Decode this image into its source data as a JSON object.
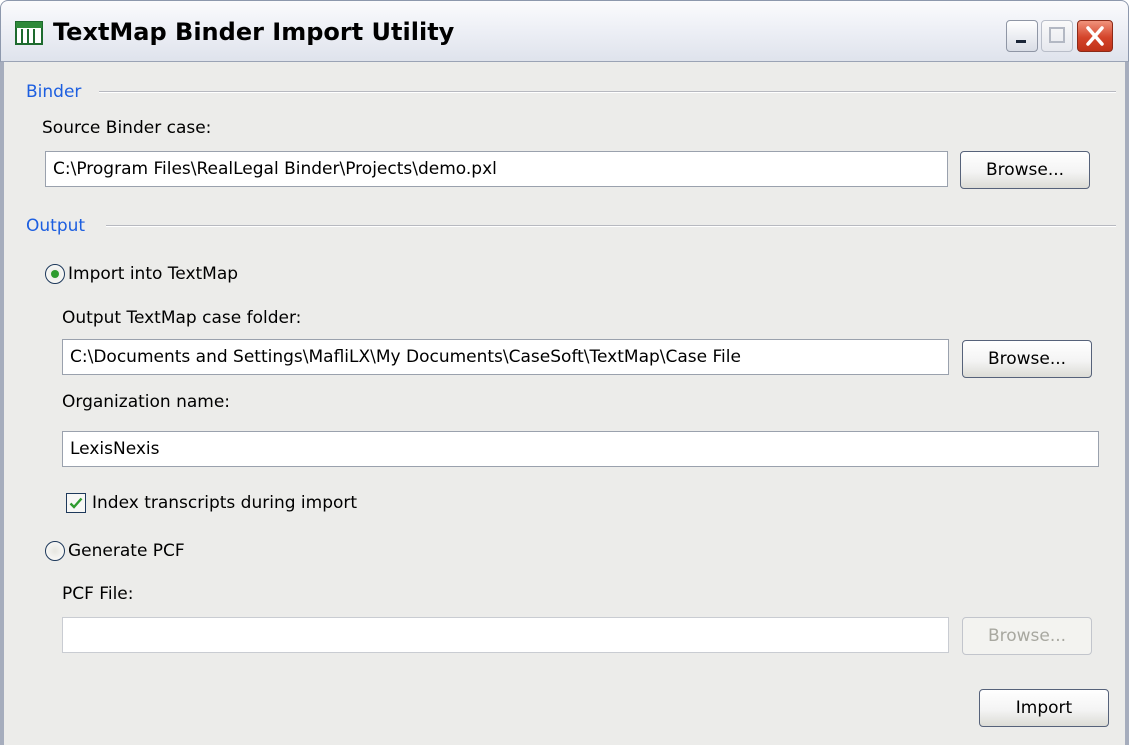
{
  "window": {
    "title": "TextMap Binder Import Utility",
    "app_icon": "textmap-app-icon",
    "controls": [
      "minimize-icon",
      "maximize-icon",
      "close-icon"
    ]
  },
  "binder": {
    "section_label": "Binder",
    "source_label": "Source Binder case:",
    "source_value": "C:\\Program Files\\RealLegal Binder\\Projects\\demo.pxl",
    "browse_label": "Browse..."
  },
  "output": {
    "section_label": "Output",
    "import_option": {
      "label": "Import into TextMap",
      "selected": true
    },
    "folder_label": "Output TextMap case folder:",
    "folder_value": "C:\\Documents and Settings\\MafliLX\\My Documents\\CaseSoft\\TextMap\\Case File",
    "folder_browse_label": "Browse...",
    "org_label": "Organization name:",
    "org_value": "LexisNexis",
    "index_checkbox": {
      "label": "Index transcripts during import",
      "checked": true
    },
    "pcf_option": {
      "label": "Generate PCF",
      "selected": false
    },
    "pcf_file_label": "PCF File:",
    "pcf_file_value": "",
    "pcf_browse_label": "Browse..."
  },
  "actions": {
    "import_label": "Import"
  },
  "colors": {
    "section_label": "#1c5ee0",
    "dialog_background": "#ececea",
    "close_button": "#d4442a",
    "radio_check": "#2e9b2e"
  }
}
